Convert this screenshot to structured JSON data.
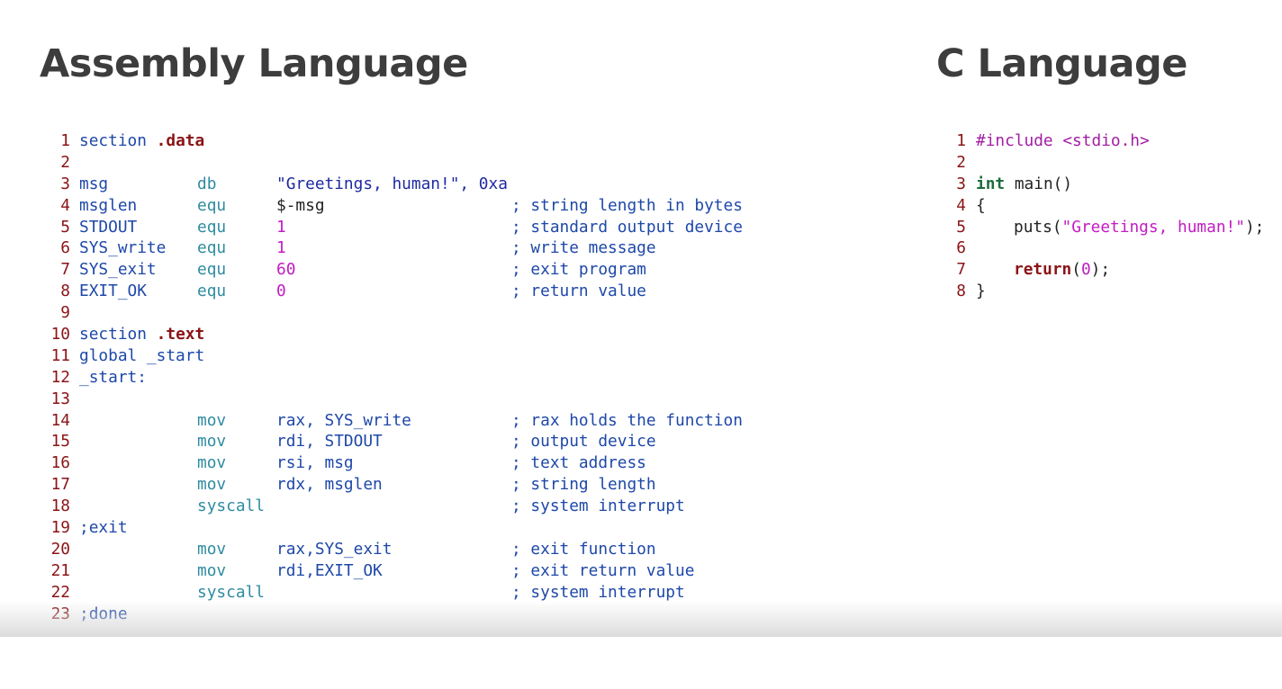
{
  "titles": {
    "assembly": "Assembly Language",
    "c": "C Language"
  },
  "asm": {
    "lines": [
      {
        "n": "1",
        "label": "section",
        "kw": ".data"
      },
      {
        "n": "2"
      },
      {
        "n": "3",
        "label": "msg",
        "op": "db",
        "arg": "\"Greetings, human!\", 0xa"
      },
      {
        "n": "4",
        "label": "msglen",
        "op": "equ",
        "arg": "$-msg",
        "comment": "; string length in bytes"
      },
      {
        "n": "5",
        "label": "STDOUT",
        "op": "equ",
        "arg": "1",
        "comment": "; standard output device"
      },
      {
        "n": "6",
        "label": "SYS_write",
        "op": "equ",
        "arg": "1",
        "comment": "; write message"
      },
      {
        "n": "7",
        "label": "SYS_exit",
        "op": "equ",
        "arg": "60",
        "comment": "; exit program"
      },
      {
        "n": "8",
        "label": "EXIT_OK",
        "op": "equ",
        "arg": "0",
        "comment": "; return value"
      },
      {
        "n": "9"
      },
      {
        "n": "10",
        "label": "section",
        "kw": ".text"
      },
      {
        "n": "11",
        "label": "global _start"
      },
      {
        "n": "12",
        "label": "_start:"
      },
      {
        "n": "13"
      },
      {
        "n": "14",
        "op": "mov",
        "arg": "rax, SYS_write",
        "comment": "; rax holds the function"
      },
      {
        "n": "15",
        "op": "mov",
        "arg": "rdi, STDOUT",
        "comment": "; output device"
      },
      {
        "n": "16",
        "op": "mov",
        "arg": "rsi, msg",
        "comment": "; text address"
      },
      {
        "n": "17",
        "op": "mov",
        "arg": "rdx, msglen",
        "comment": "; string length"
      },
      {
        "n": "18",
        "op": "syscall",
        "comment": "; system interrupt"
      },
      {
        "n": "19",
        "label": ";exit"
      },
      {
        "n": "20",
        "op": "mov",
        "arg": "rax,SYS_exit",
        "comment": "; exit function"
      },
      {
        "n": "21",
        "op": "mov",
        "arg": "rdi,EXIT_OK",
        "comment": "; exit return value"
      },
      {
        "n": "22",
        "op": "syscall",
        "comment": "; system interrupt"
      },
      {
        "n": "23",
        "label": ";done"
      }
    ]
  },
  "c": {
    "lines": [
      {
        "n": "1",
        "include": "#include <stdio.h>"
      },
      {
        "n": "2"
      },
      {
        "n": "3",
        "type": "int",
        "rest": " main()"
      },
      {
        "n": "4",
        "brace": "{"
      },
      {
        "n": "5",
        "fn": "puts(",
        "str": "\"Greetings, human!\"",
        "end": ");"
      },
      {
        "n": "6"
      },
      {
        "n": "7",
        "ret": "return",
        "open": "(",
        "num": "0",
        "close": ");"
      },
      {
        "n": "8",
        "brace": "}"
      }
    ]
  },
  "colors": {
    "title": "#3d3d3d",
    "line_number": "#8a1416",
    "asm_text": "#1e48a8",
    "asm_mnemonic": "#2e8ba0",
    "keyword_section": "#8a1416",
    "string": "#1e2aa0",
    "number": "#c21cc2",
    "c_type": "#1f6b3b",
    "c_preprocessor": "#a21ea2"
  }
}
